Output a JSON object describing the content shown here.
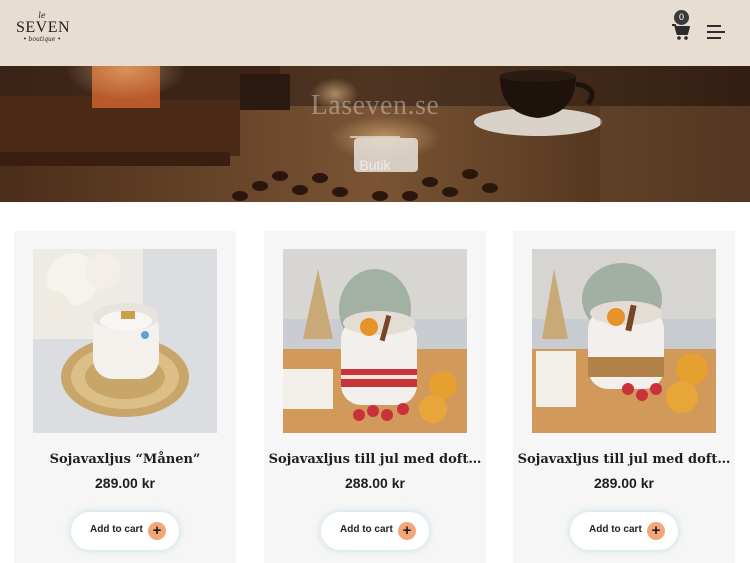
{
  "header": {
    "logo": {
      "top": "le",
      "main": "SEVEN",
      "sub": "• boutique •"
    },
    "cart_count": "0"
  },
  "hero": {
    "title": "Laseven.se",
    "subtitle": "Butik"
  },
  "products": [
    {
      "name": "Sojavaxljus “Månen”",
      "price": "289.00 kr",
      "button": "Add to cart"
    },
    {
      "name": "Sojavaxljus till jul med doft…",
      "price": "288.00 kr",
      "button": "Add to cart"
    },
    {
      "name": "Sojavaxljus till jul med doft…",
      "price": "289.00 kr",
      "button": "Add to cart"
    }
  ],
  "colors": {
    "header_bg": "#e7ddd0",
    "card_bg": "#f7f6f6",
    "plus_accent": "#f2a679"
  }
}
